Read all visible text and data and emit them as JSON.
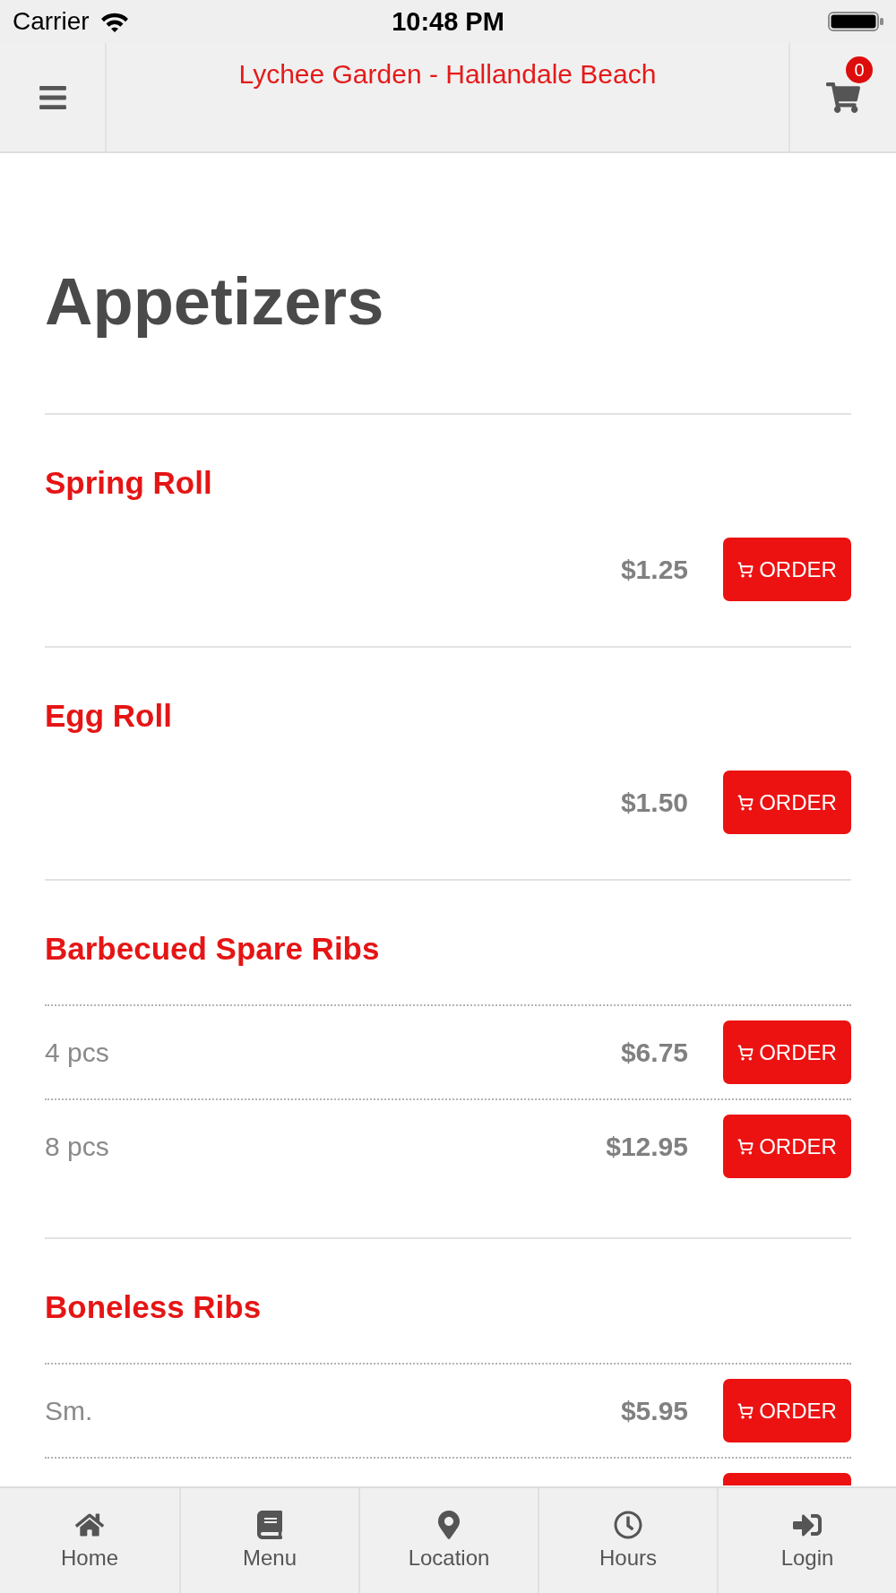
{
  "status_bar": {
    "carrier": "Carrier",
    "time": "10:48 PM"
  },
  "header": {
    "title": "Lychee Garden - Hallandale Beach",
    "cart_count": "0"
  },
  "section": {
    "title": "Appetizers",
    "more_below": true
  },
  "items": [
    {
      "name": "Spring Roll",
      "kind": "single",
      "options": [
        {
          "price": "$1.25",
          "button": "ORDER"
        }
      ]
    },
    {
      "name": "Egg Roll",
      "kind": "single",
      "options": [
        {
          "price": "$1.50",
          "button": "ORDER"
        }
      ]
    },
    {
      "name": "Barbecued Spare Ribs",
      "kind": "sized",
      "options": [
        {
          "size": "4 pcs",
          "price": "$6.75",
          "button": "ORDER"
        },
        {
          "size": "8 pcs",
          "price": "$12.95",
          "button": "ORDER"
        }
      ]
    },
    {
      "name": "Boneless Ribs",
      "kind": "sized",
      "options": [
        {
          "size": "Sm.",
          "price": "$5.95",
          "button": "ORDER"
        }
      ]
    }
  ],
  "tab_bar": [
    {
      "label": "Home"
    },
    {
      "label": "Menu"
    },
    {
      "label": "Location"
    },
    {
      "label": "Hours"
    },
    {
      "label": "Login"
    }
  ]
}
